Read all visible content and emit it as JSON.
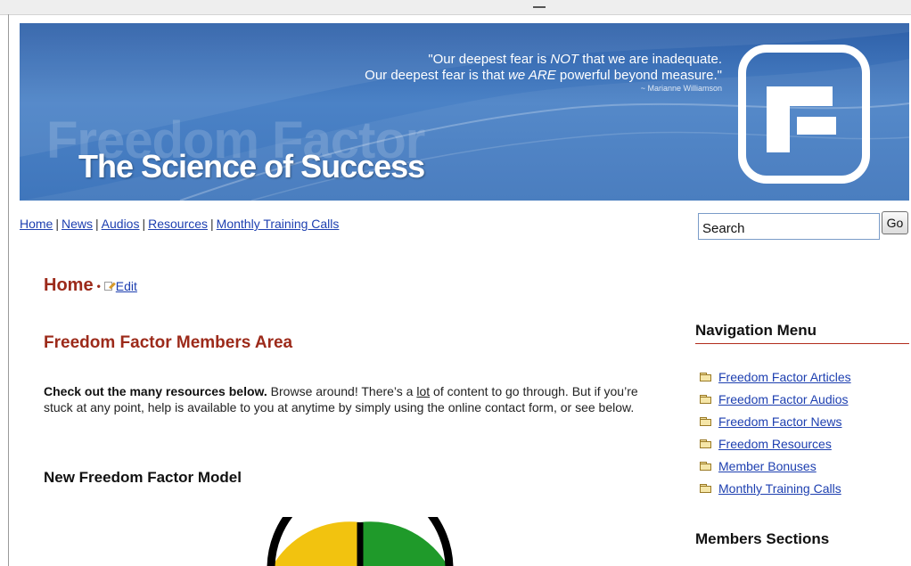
{
  "banner": {
    "watermark": "Freedom Factor",
    "tagline": "The Science of Success",
    "quote": {
      "line1_pre": "\"Our deepest fear is ",
      "line1_em": "NOT",
      "line1_post": " that we are inadequate.",
      "line2_pre": "Our deepest fear is that ",
      "line2_em1": "we ARE",
      "line2_post": " powerful beyond measure.\"",
      "author": "~ Marianne Williamson"
    },
    "logo_icon": "freedom-factor-f-logo"
  },
  "nav": {
    "links": [
      "Home",
      "News",
      "Audios",
      "Resources",
      "Monthly Training Calls"
    ],
    "separator": "|"
  },
  "search": {
    "value": "Search",
    "button_label": "Go"
  },
  "page": {
    "title": "Home",
    "bullet": "•",
    "edit_label": "Edit",
    "section_title": "Freedom Factor Members Area",
    "intro_bold": "Check out the many resources below.",
    "intro_part1": " Browse around! There’s a ",
    "intro_link": "lot",
    "intro_part2": " of content to go through. But if you’re stuck at any point, help is available to you at anytime by simply using the online contact form, or see below.",
    "model_title": "New Freedom Factor Model"
  },
  "sidebar": {
    "nav_heading": "Navigation Menu",
    "items": [
      "Freedom Factor Articles",
      "Freedom Factor Audios",
      "Freedom Factor News",
      "Freedom Resources",
      "Member Bonuses",
      "Monthly Training Calls"
    ],
    "members_heading": "Members Sections"
  },
  "colors": {
    "banner_blue": "#3f76bc",
    "heading_red": "#9c2a1a",
    "link_blue": "#1d3fb0",
    "model_yellow": "#f2c30f",
    "model_green": "#1f9a2a"
  }
}
